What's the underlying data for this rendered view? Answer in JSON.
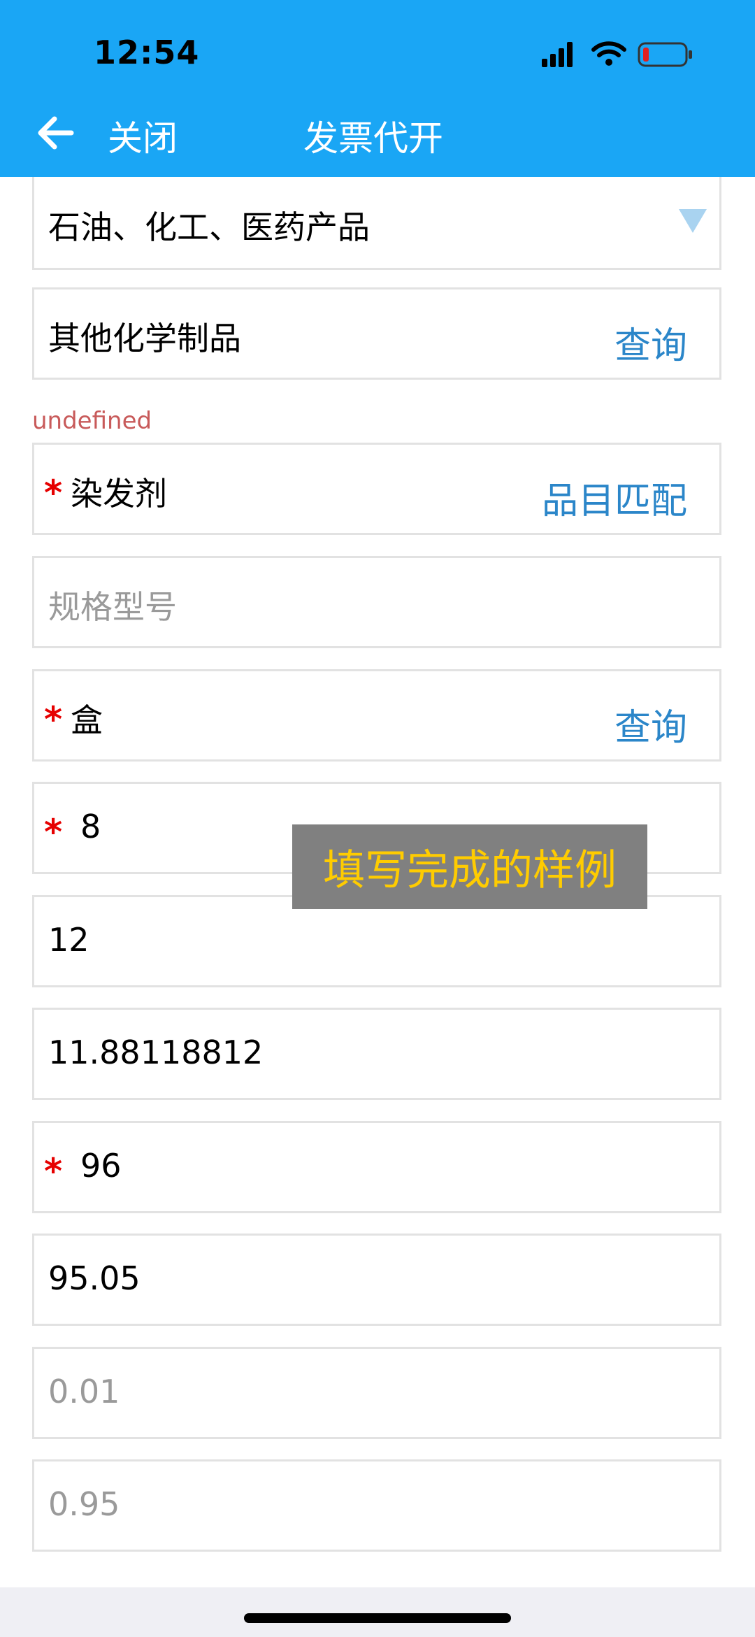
{
  "status": {
    "time": "12:54"
  },
  "nav": {
    "close_label": "关闭",
    "title": "发票代开"
  },
  "form": {
    "category": "石油、化工、医药产品",
    "subcategory": "其他化学制品",
    "subcategory_action": "查询",
    "undefined_label": "undefined",
    "item_name": "染发剂",
    "item_action": "品目匹配",
    "spec_placeholder": "规格型号",
    "unit": "盒",
    "unit_action": "查询",
    "quantity": "8",
    "price": "12",
    "price_excl_tax": "11.88118812",
    "amount": "96",
    "amount_excl_tax": "95.05",
    "tax_rate": "0.01",
    "tax_amount": "0.95",
    "required_mark": "*"
  },
  "toast": {
    "text": "填写完成的样例"
  },
  "colors": {
    "header": "#1aa6f5",
    "action": "#2b86c9",
    "required": "#e60000",
    "toast_text": "#ffcc00"
  }
}
